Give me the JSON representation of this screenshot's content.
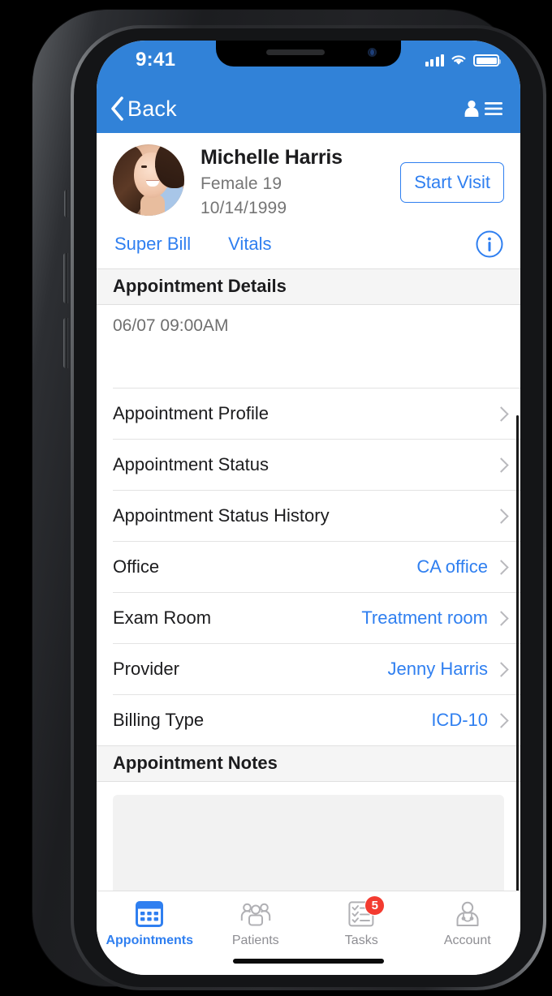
{
  "theme": {
    "brand": "#3182d8",
    "brand_light": "#2f7ff0",
    "badge": "#f33b30",
    "section_bg": "#f5f5f5"
  },
  "status_bar": {
    "time": "9:41",
    "signal_icon": "cellular-signal-icon",
    "wifi_icon": "wifi-icon",
    "battery_icon": "battery-icon"
  },
  "nav_bar": {
    "back_label": "Back",
    "back_icon": "chevron-left-icon",
    "contacts_icon": "contact-list-icon"
  },
  "patient": {
    "name": "Michelle Harris",
    "demographics": "Female 19",
    "dob": "10/14/1999",
    "avatar_icon": "patient-avatar",
    "start_visit_label": "Start Visit",
    "links": [
      {
        "label": "Super Bill",
        "name": "super-bill-link"
      },
      {
        "label": "Vitals",
        "name": "vitals-link"
      }
    ],
    "info_icon": "info-circle-icon"
  },
  "appointment_details": {
    "section_title": "Appointment Details",
    "datetime": "06/07 09:00AM",
    "rows": [
      {
        "label": "Appointment Profile",
        "value": ""
      },
      {
        "label": "Appointment Status",
        "value": ""
      },
      {
        "label": "Appointment Status History",
        "value": ""
      },
      {
        "label": "Office",
        "value": "CA office"
      },
      {
        "label": "Exam Room",
        "value": "Treatment room"
      },
      {
        "label": "Provider",
        "value": "Jenny Harris"
      },
      {
        "label": "Billing Type",
        "value": "ICD-10"
      }
    ]
  },
  "appointment_notes": {
    "section_title": "Appointment Notes",
    "notes_value": ""
  },
  "tab_bar": {
    "items": [
      {
        "label": "Appointments",
        "icon": "calendar-icon",
        "active": true,
        "badge": ""
      },
      {
        "label": "Patients",
        "icon": "people-group-icon",
        "active": false,
        "badge": ""
      },
      {
        "label": "Tasks",
        "icon": "checklist-icon",
        "active": false,
        "badge": "5"
      },
      {
        "label": "Account",
        "icon": "doctor-stethoscope-icon",
        "active": false,
        "badge": ""
      }
    ]
  }
}
